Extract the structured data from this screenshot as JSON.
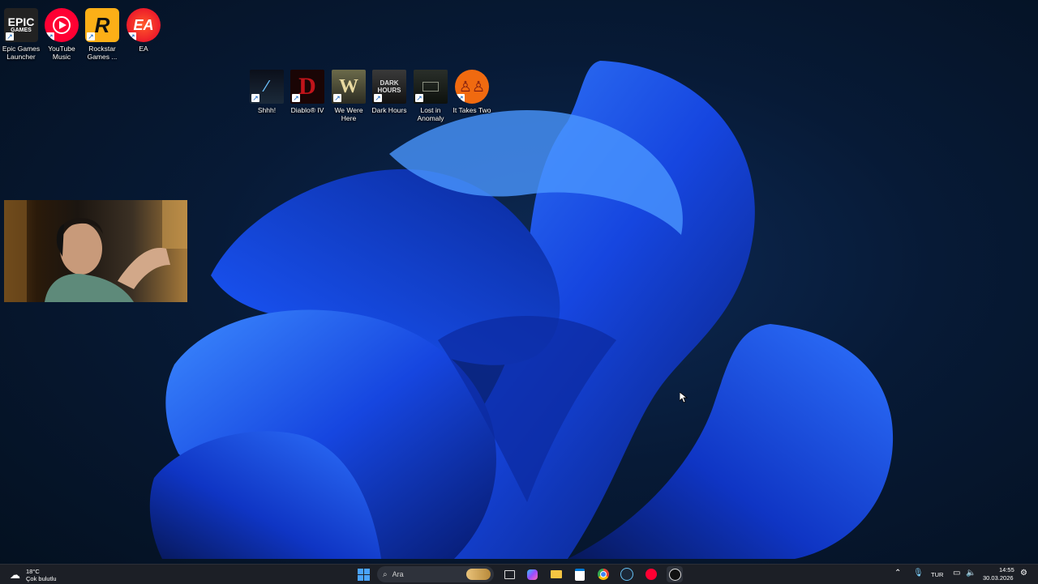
{
  "desktop_top_icons": [
    {
      "label": "Epic Games Launcher",
      "icon": "epic-games-icon"
    },
    {
      "label": "YouTube Music",
      "icon": "youtube-music-icon"
    },
    {
      "label": "Rockstar Games ...",
      "icon": "rockstar-icon"
    },
    {
      "label": "EA",
      "icon": "ea-icon"
    }
  ],
  "desktop_game_icons": [
    {
      "label": "Shhh!",
      "icon": "shhh-game-icon"
    },
    {
      "label": "Diablo® IV",
      "icon": "diablo-icon"
    },
    {
      "label": "We Were Here",
      "icon": "we-were-here-icon"
    },
    {
      "label": "Dark Hours",
      "icon": "dark-hours-icon"
    },
    {
      "label": "Lost in Anomaly",
      "icon": "lost-in-anomaly-icon"
    },
    {
      "label": "It Takes Two",
      "icon": "it-takes-two-icon"
    }
  ],
  "icon_texts": {
    "epic_line1": "EPIC",
    "epic_line2": "GAMES",
    "rockstar_letter": "R",
    "ea_text": "EA",
    "diablo_letter": "D",
    "wewere_letter": "W",
    "dark_hours": "DARK HOURS"
  },
  "taskbar": {
    "weather_temp": "18°C",
    "weather_desc": "Çok bulutlu",
    "search_placeholder": "Ara",
    "language": "TUR",
    "time": "14:55",
    "date": "30.03.2026"
  },
  "colors": {
    "wallpaper_blue": "#1e5cff",
    "taskbar_bg": "#1c1f26",
    "accent": "#4aa3ff"
  }
}
